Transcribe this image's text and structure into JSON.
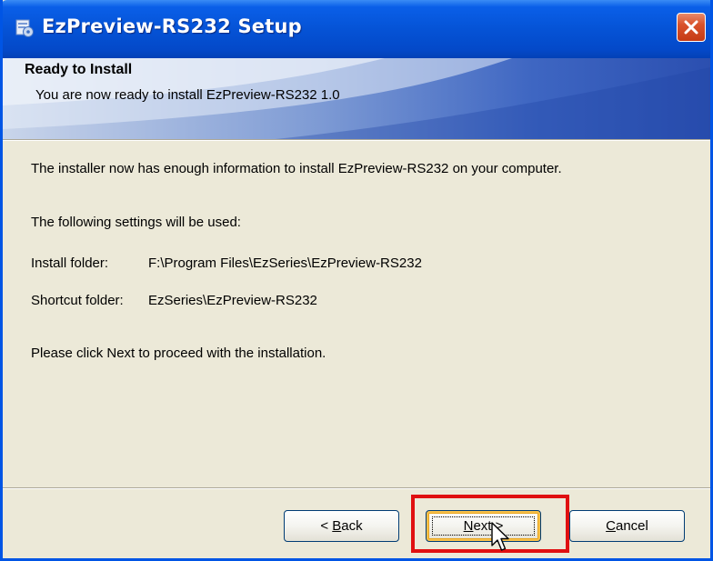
{
  "window": {
    "title": "EzPreview-RS232 Setup",
    "title_icon": "installer-icon",
    "close_icon": "close-icon"
  },
  "banner": {
    "title": "Ready to Install",
    "subtitle": "You are now ready to install EzPreview-RS232 1.0"
  },
  "content": {
    "intro": "The installer now has enough information to install EzPreview-RS232 on your computer.",
    "settings_heading": "The following settings will be used:",
    "install_folder_label": "Install folder:",
    "install_folder_value": "F:\\Program Files\\EzSeries\\EzPreview-RS232",
    "shortcut_folder_label": "Shortcut folder:",
    "shortcut_folder_value": "EzSeries\\EzPreview-RS232",
    "instruction": "Please click Next to proceed with the installation."
  },
  "buttons": {
    "back": {
      "prefix": "< ",
      "mnemonic": "B",
      "rest": "ack"
    },
    "next": {
      "mnemonic": "N",
      "rest": "ext >"
    },
    "cancel": {
      "mnemonic": "C",
      "rest": "ancel"
    }
  },
  "colors": {
    "titlebar": "#0553d6",
    "highlight": "#e01010",
    "window_bg": "#ece9d8"
  }
}
